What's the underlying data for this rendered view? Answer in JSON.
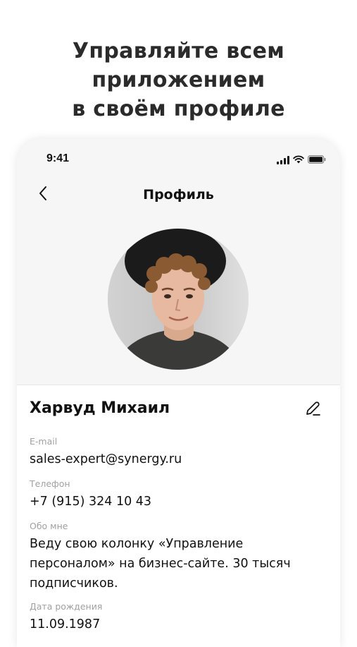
{
  "promo": {
    "headline_lines": [
      "Управляйте всем",
      "приложением",
      "в своём профиле"
    ]
  },
  "status_bar": {
    "time": "9:41",
    "icons": [
      "cellular-signal-icon",
      "wifi-icon",
      "battery-icon"
    ]
  },
  "nav": {
    "back_icon": "chevron-left-icon",
    "title": "Профиль"
  },
  "profile": {
    "name": "Харвуд Михаил",
    "edit_icon": "pencil-icon",
    "fields": [
      {
        "label": "E-mail",
        "value": "sales-expert@synergy.ru"
      },
      {
        "label": "Телефон",
        "value": "+7 (915) 324 10 43"
      },
      {
        "label": "Обо мне",
        "value": "Веду свою колонку «Управление персоналом» на бизнес-сайте. 30 тысяч подписчиков."
      },
      {
        "label": "Дата рождения",
        "value": "11.09.1987"
      }
    ]
  },
  "colors": {
    "background": "#ffffff",
    "phone_background": "#f6f6f6",
    "text_primary": "#111111",
    "text_secondary": "#a0a0a0"
  }
}
